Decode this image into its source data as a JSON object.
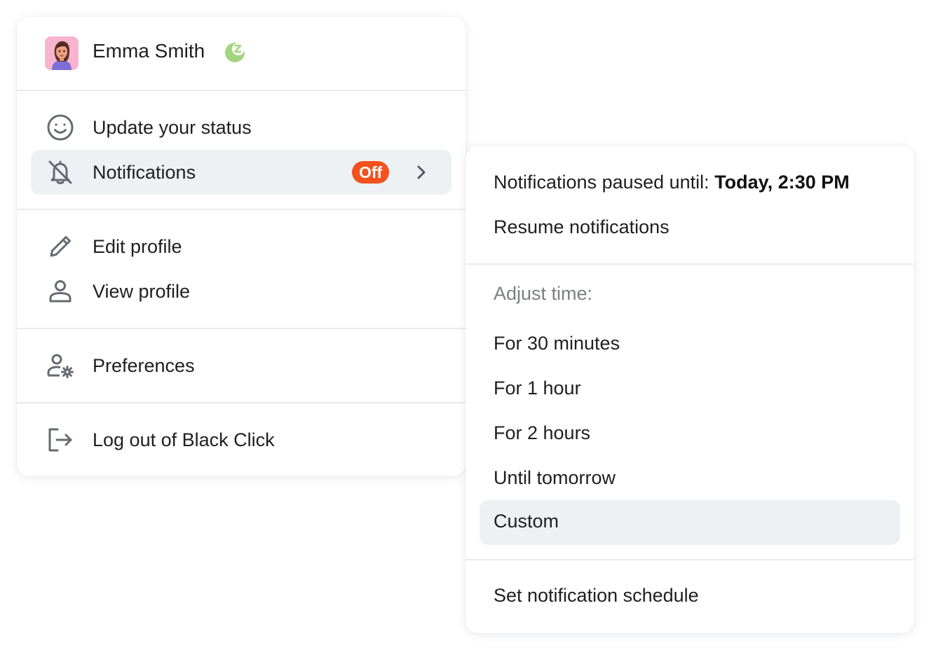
{
  "user": {
    "name": "Emma Smith",
    "status_icon": "snooze-icon"
  },
  "main_menu": {
    "update_status": {
      "label": "Update your status",
      "icon": "smiley-icon"
    },
    "notifications": {
      "label": "Notifications",
      "icon": "bell-off-icon",
      "badge": "Off",
      "badge_color": "#f4511e"
    },
    "edit_profile": {
      "label": "Edit profile",
      "icon": "pencil-icon"
    },
    "view_profile": {
      "label": "View profile",
      "icon": "person-icon"
    },
    "preferences": {
      "label": "Preferences",
      "icon": "person-gear-icon"
    },
    "logout": {
      "label": "Log out of Black Click",
      "icon": "logout-icon"
    }
  },
  "submenu": {
    "paused_prefix": "Notifications paused until: ",
    "paused_until": "Today, 2:30 PM",
    "resume": "Resume notifications",
    "adjust_heading": "Adjust time:",
    "options": [
      "For 30 minutes",
      "For 1 hour",
      "For 2 hours",
      "Until tomorrow",
      "Custom"
    ],
    "selected_option": "Custom",
    "schedule": "Set notification schedule"
  },
  "colors": {
    "highlight": "#eef1f4",
    "status_green": "#a5d67f",
    "badge_orange": "#f4511e"
  }
}
